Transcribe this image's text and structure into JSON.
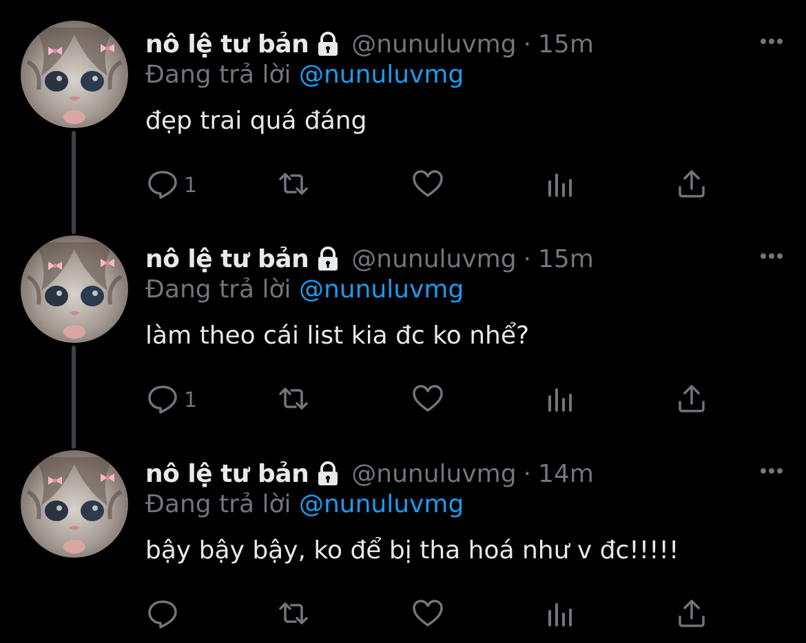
{
  "colors": {
    "background": "#000000",
    "name": "#e7e9ea",
    "muted": "#71767b",
    "link": "#1d9bf0",
    "thread_line": "#3d4144"
  },
  "tweets": [
    {
      "display_name": "nô lệ tư bản",
      "handle": "@nunuluvmg",
      "separator": "·",
      "time": "15m",
      "reply_prefix": "Đang trả lời",
      "reply_handle": "@nunuluvmg",
      "text": "đẹp trai quá đáng",
      "reply_count": "1",
      "protected": true
    },
    {
      "display_name": "nô lệ tư bản",
      "handle": "@nunuluvmg",
      "separator": "·",
      "time": "15m",
      "reply_prefix": "Đang trả lời",
      "reply_handle": "@nunuluvmg",
      "text": "làm theo cái list kia đc ko nhể?",
      "reply_count": "1",
      "protected": true
    },
    {
      "display_name": "nô lệ tư bản",
      "handle": "@nunuluvmg",
      "separator": "·",
      "time": "14m",
      "reply_prefix": "Đang trả lời",
      "reply_handle": "@nunuluvmg",
      "text": "bậy bậy bậy, ko để bị tha hoá như v đc!!!!!",
      "reply_count": "",
      "protected": true
    }
  ],
  "icons": {
    "lock": "lock-icon",
    "more": "more-icon",
    "reply": "reply-icon",
    "retweet": "retweet-icon",
    "like": "heart-icon",
    "views": "views-icon",
    "share": "share-icon"
  }
}
